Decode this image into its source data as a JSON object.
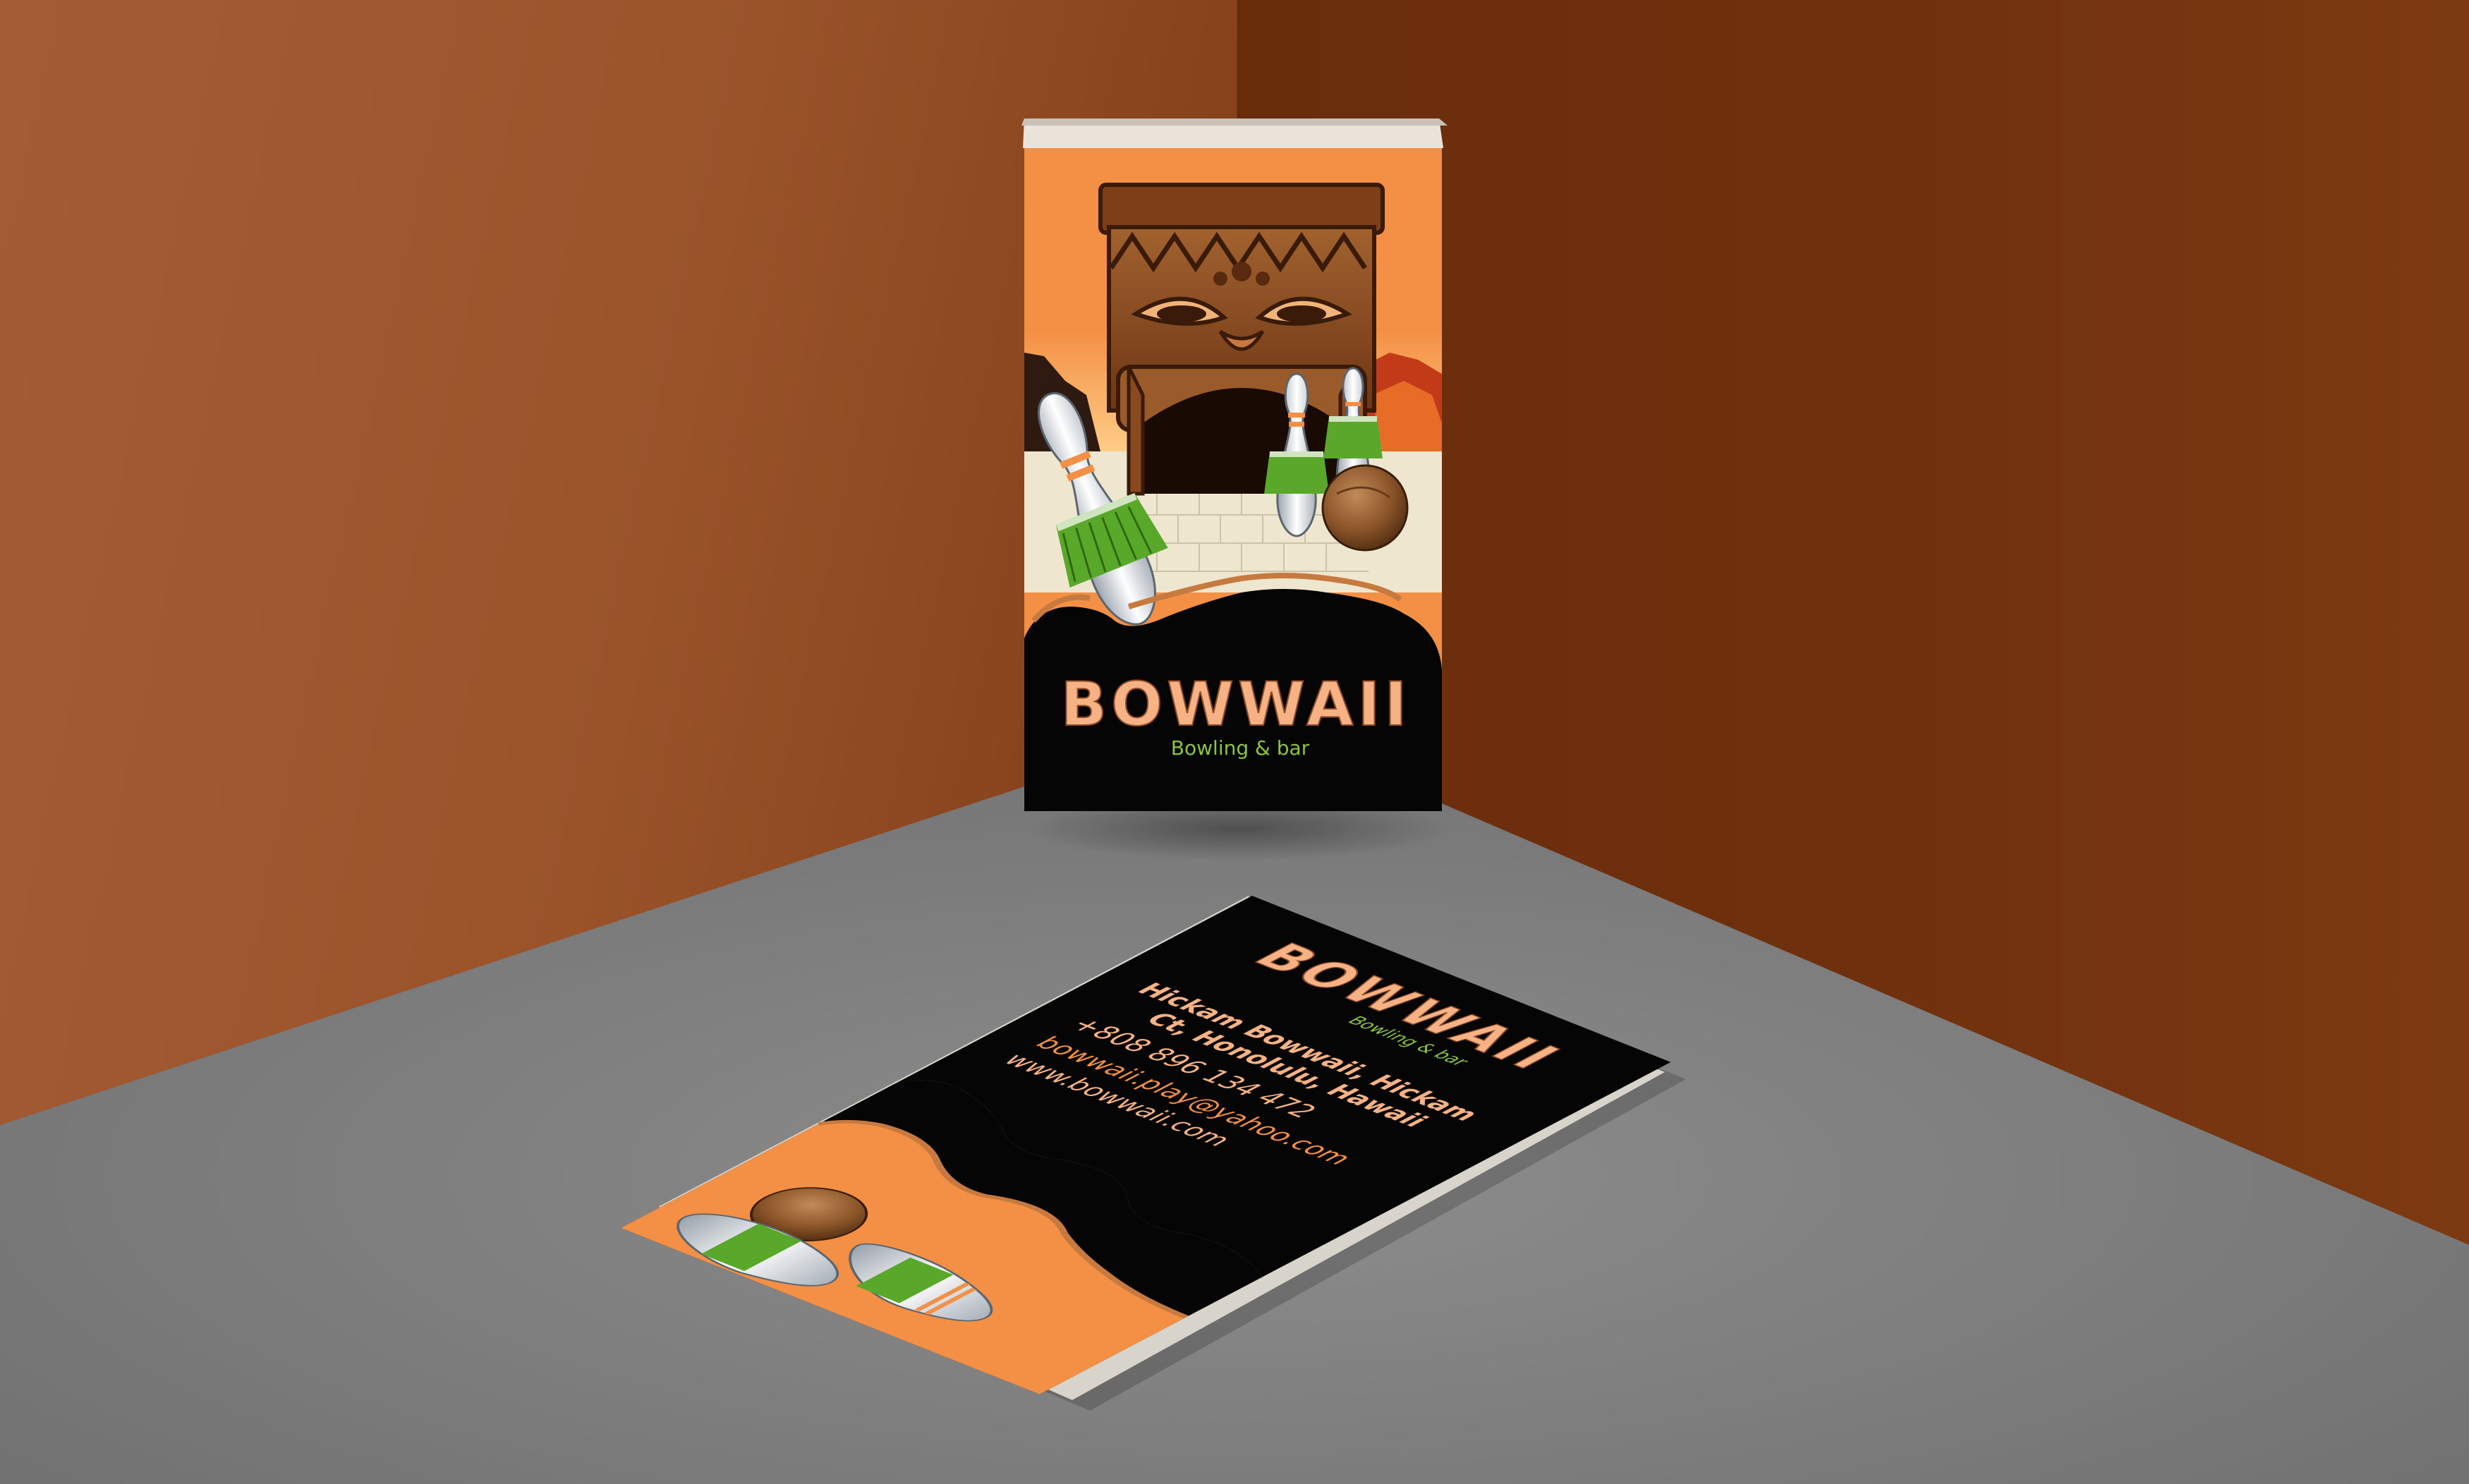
{
  "front_card": {
    "brand": "BOWWAII",
    "tagline": "Bowling & bar"
  },
  "back_card": {
    "brand": "BOWWAII",
    "tagline": "Bowling & bar",
    "address_line1": "Hickam Bowwaii, Hickam",
    "address_line2": "Ct, Honolulu, Hawaii",
    "phone": "+808 896 134 472",
    "email": "bowwaii.play@yahoo.com",
    "website": "www.bowwaii.com"
  },
  "colors": {
    "wall_left": "#9a5530",
    "wall_right": "#6b2f0c",
    "floor": "#7f7f7f",
    "card_orange": "#f39045",
    "card_black": "#050505",
    "brand_peach": "#f6b184",
    "tagline_green": "#8cc43e",
    "tiki_brown": "#8b4a22"
  },
  "icons": [
    "tiki-mask-icon",
    "bowling-pin-icon",
    "coconut-ball-icon",
    "grass-skirt-icon"
  ]
}
